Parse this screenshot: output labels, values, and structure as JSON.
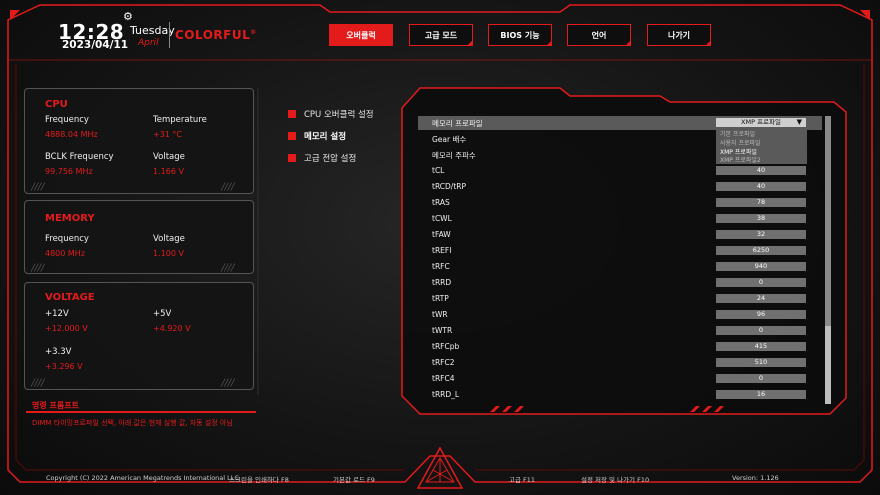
{
  "header": {
    "time": "12:28",
    "date": "2023/04/11",
    "weekday": "Tuesday",
    "month": "April",
    "brand": "COLORFUL",
    "brand_mark": "®"
  },
  "nav": {
    "tabs": [
      {
        "label": "오버클럭",
        "active": true
      },
      {
        "label": "고급 모드",
        "active": false
      },
      {
        "label": "BIOS 기능",
        "active": false
      },
      {
        "label": "언어",
        "active": false
      },
      {
        "label": "나가기",
        "active": false
      }
    ]
  },
  "cpu": {
    "title": "CPU",
    "frequency_label": "Frequency",
    "frequency_value": "4888.04 MHz",
    "temperature_label": "Temperature",
    "temperature_value": "+31 °C",
    "bclk_label": "BCLK Frequency",
    "bclk_value": "99.756 MHz",
    "voltage_label": "Voltage",
    "voltage_value": "1.166 V"
  },
  "memory": {
    "title": "MEMORY",
    "frequency_label": "Frequency",
    "frequency_value": "4800 MHz",
    "voltage_label": "Voltage",
    "voltage_value": "1.100 V"
  },
  "voltage": {
    "title": "VOLTAGE",
    "v12_label": "+12V",
    "v12_value": "+12.000 V",
    "v5_label": "+5V",
    "v5_value": "+4.920 V",
    "v33_label": "+3.3V",
    "v33_value": "+3.296 V"
  },
  "prompt": {
    "title": "명령 프롬프트",
    "text": "DIMM 타이밍프로파일 선택, 아래 값은 현재 실행 값, 자동 설정 아님"
  },
  "menu": {
    "items": [
      {
        "label": "CPU 오버클럭 설정",
        "active": false
      },
      {
        "label": "메모리 설정",
        "active": true
      },
      {
        "label": "고급 전압 설정",
        "active": false
      }
    ]
  },
  "settings": {
    "rows": [
      {
        "name": "메모리 프로파일",
        "value": "XMP 프로파일"
      },
      {
        "name": "Gear 배수",
        "value": ""
      },
      {
        "name": "메모리 주파수",
        "value": ""
      },
      {
        "name": "tCL",
        "value": "40"
      },
      {
        "name": "tRCD/tRP",
        "value": "40"
      },
      {
        "name": "tRAS",
        "value": "78"
      },
      {
        "name": "tCWL",
        "value": "38"
      },
      {
        "name": "tFAW",
        "value": "32"
      },
      {
        "name": "tREFI",
        "value": "6250"
      },
      {
        "name": "tRFC",
        "value": "940"
      },
      {
        "name": "tRRD",
        "value": "0"
      },
      {
        "name": "tRTP",
        "value": "24"
      },
      {
        "name": "tWR",
        "value": "96"
      },
      {
        "name": "tWTR",
        "value": "0"
      },
      {
        "name": "tRFCpb",
        "value": "415"
      },
      {
        "name": "tRFC2",
        "value": "510"
      },
      {
        "name": "tRFC4",
        "value": "0"
      },
      {
        "name": "tRRD_L",
        "value": "16"
      }
    ],
    "dropdown_options": [
      "기본 프로파일",
      "사용자 프로파일",
      "XMP 프로파일",
      "XMP 프로파일2"
    ],
    "dropdown_selected": "XMP 프로파일"
  },
  "footer": {
    "copyright": "Copyright (C) 2022 American Megatrends International LLC",
    "print_screen": "스크린을 인쇄하다 F8",
    "load_default": "기본값 로드 F9",
    "advanced": "고급 F11",
    "save_exit": "설정 저장 및 나가기 F10",
    "version": "Version: 1.126"
  },
  "colors": {
    "accent": "#e31b1b",
    "background": "#141414",
    "panel_border": "#555555"
  },
  "icons": [
    "gear-icon",
    "scroll-down-arrow-icon",
    "colorful-emblem-icon"
  ]
}
